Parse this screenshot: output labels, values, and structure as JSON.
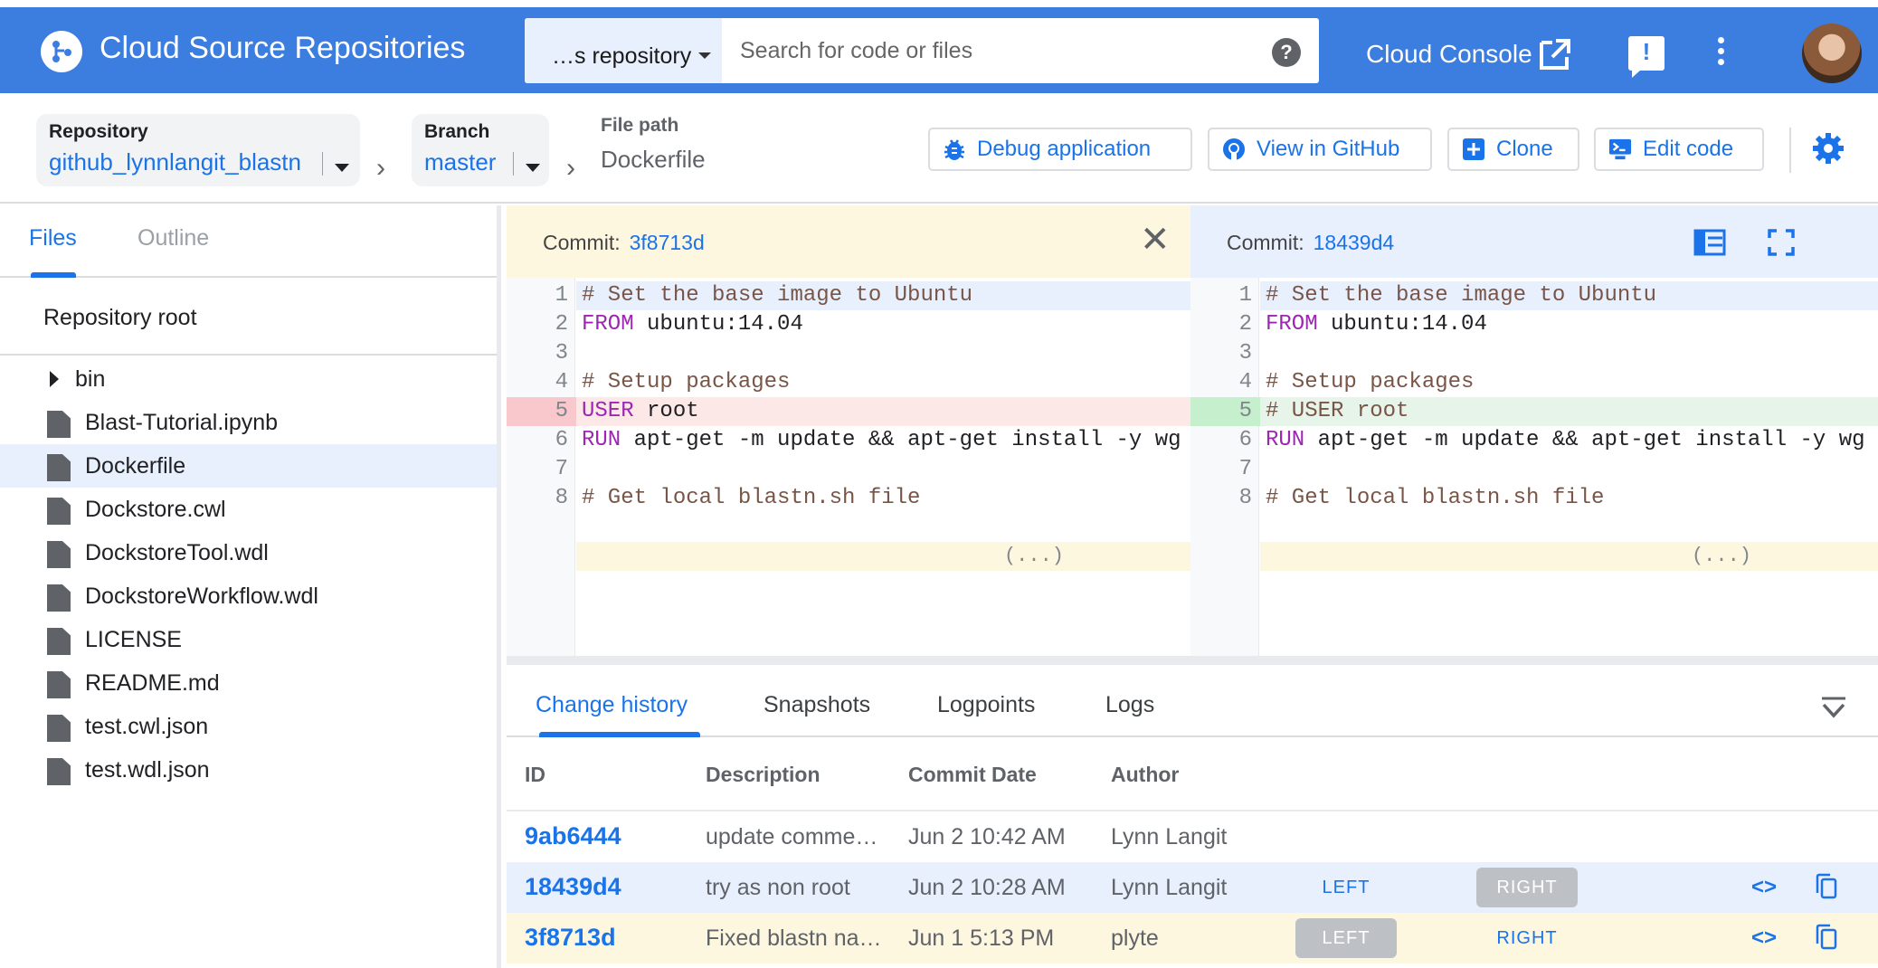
{
  "header": {
    "app_title": "Cloud Source Repositories",
    "repo_selector": "…s repository",
    "search_placeholder": "Search for code or files",
    "console_link": "Cloud Console",
    "brand_color": "#3c7de0"
  },
  "toolbar": {
    "repository_label": "Repository",
    "repository_value": "github_lynnlangit_blastn",
    "branch_label": "Branch",
    "branch_value": "master",
    "filepath_label": "File path",
    "filepath_value": "Dockerfile",
    "debug_button": "Debug application",
    "github_button": "View in GitHub",
    "clone_button": "Clone",
    "edit_button": "Edit code"
  },
  "sidebar": {
    "tabs": [
      "Files",
      "Outline"
    ],
    "root_label": "Repository root",
    "items": [
      {
        "name": "bin",
        "type": "folder"
      },
      {
        "name": "Blast-Tutorial.ipynb",
        "type": "file"
      },
      {
        "name": "Dockerfile",
        "type": "file",
        "selected": true
      },
      {
        "name": "Dockstore.cwl",
        "type": "file"
      },
      {
        "name": "DockstoreTool.wdl",
        "type": "file"
      },
      {
        "name": "DockstoreWorkflow.wdl",
        "type": "file"
      },
      {
        "name": "LICENSE",
        "type": "file"
      },
      {
        "name": "README.md",
        "type": "file"
      },
      {
        "name": "test.cwl.json",
        "type": "file"
      },
      {
        "name": "test.wdl.json",
        "type": "file"
      }
    ]
  },
  "diff": {
    "commit_label": "Commit:",
    "left_commit": "3f8713d",
    "right_commit": "18439d4",
    "ellipsis": "(...)",
    "left_lines": [
      {
        "n": "1",
        "code": "# Set the base image to Ubuntu",
        "kind": "comment"
      },
      {
        "n": "2",
        "kw": "FROM",
        "rest": " ubuntu:14.04"
      },
      {
        "n": "3",
        "code": ""
      },
      {
        "n": "4",
        "code": "# Setup packages",
        "kind": "comment"
      },
      {
        "n": "5",
        "kw": "USER",
        "rest": " root",
        "change": "removed"
      },
      {
        "n": "6",
        "kw": "RUN",
        "rest": " apt-get -m update && apt-get install -y wg"
      },
      {
        "n": "7",
        "code": ""
      },
      {
        "n": "8",
        "code": "# Get local blastn.sh file",
        "kind": "comment"
      }
    ],
    "right_lines": [
      {
        "n": "1",
        "code": "# Set the base image to Ubuntu",
        "kind": "comment"
      },
      {
        "n": "2",
        "kw": "FROM",
        "rest": " ubuntu:14.04"
      },
      {
        "n": "3",
        "code": ""
      },
      {
        "n": "4",
        "code": "# Setup packages",
        "kind": "comment"
      },
      {
        "n": "5",
        "code": "# USER root",
        "kind": "comment",
        "change": "added"
      },
      {
        "n": "6",
        "kw": "RUN",
        "rest": " apt-get -m update && apt-get install -y wg"
      },
      {
        "n": "7",
        "code": ""
      },
      {
        "n": "8",
        "code": "# Get local blastn.sh file",
        "kind": "comment"
      }
    ]
  },
  "history": {
    "tabs": [
      "Change history",
      "Snapshots",
      "Logpoints",
      "Logs"
    ],
    "columns": [
      "ID",
      "Description",
      "Commit Date",
      "Author"
    ],
    "left_label": "LEFT",
    "right_label": "RIGHT",
    "rows": [
      {
        "id": "9ab6444",
        "description": "update comme…",
        "date": "Jun 2 10:42 AM",
        "author": "Lynn Langit"
      },
      {
        "id": "18439d4",
        "description": "try as non root",
        "date": "Jun 2 10:28 AM",
        "author": "Lynn Langit"
      },
      {
        "id": "3f8713d",
        "description": "Fixed blastn na…",
        "date": "Jun 1 5:13 PM",
        "author": "plyte"
      }
    ]
  }
}
